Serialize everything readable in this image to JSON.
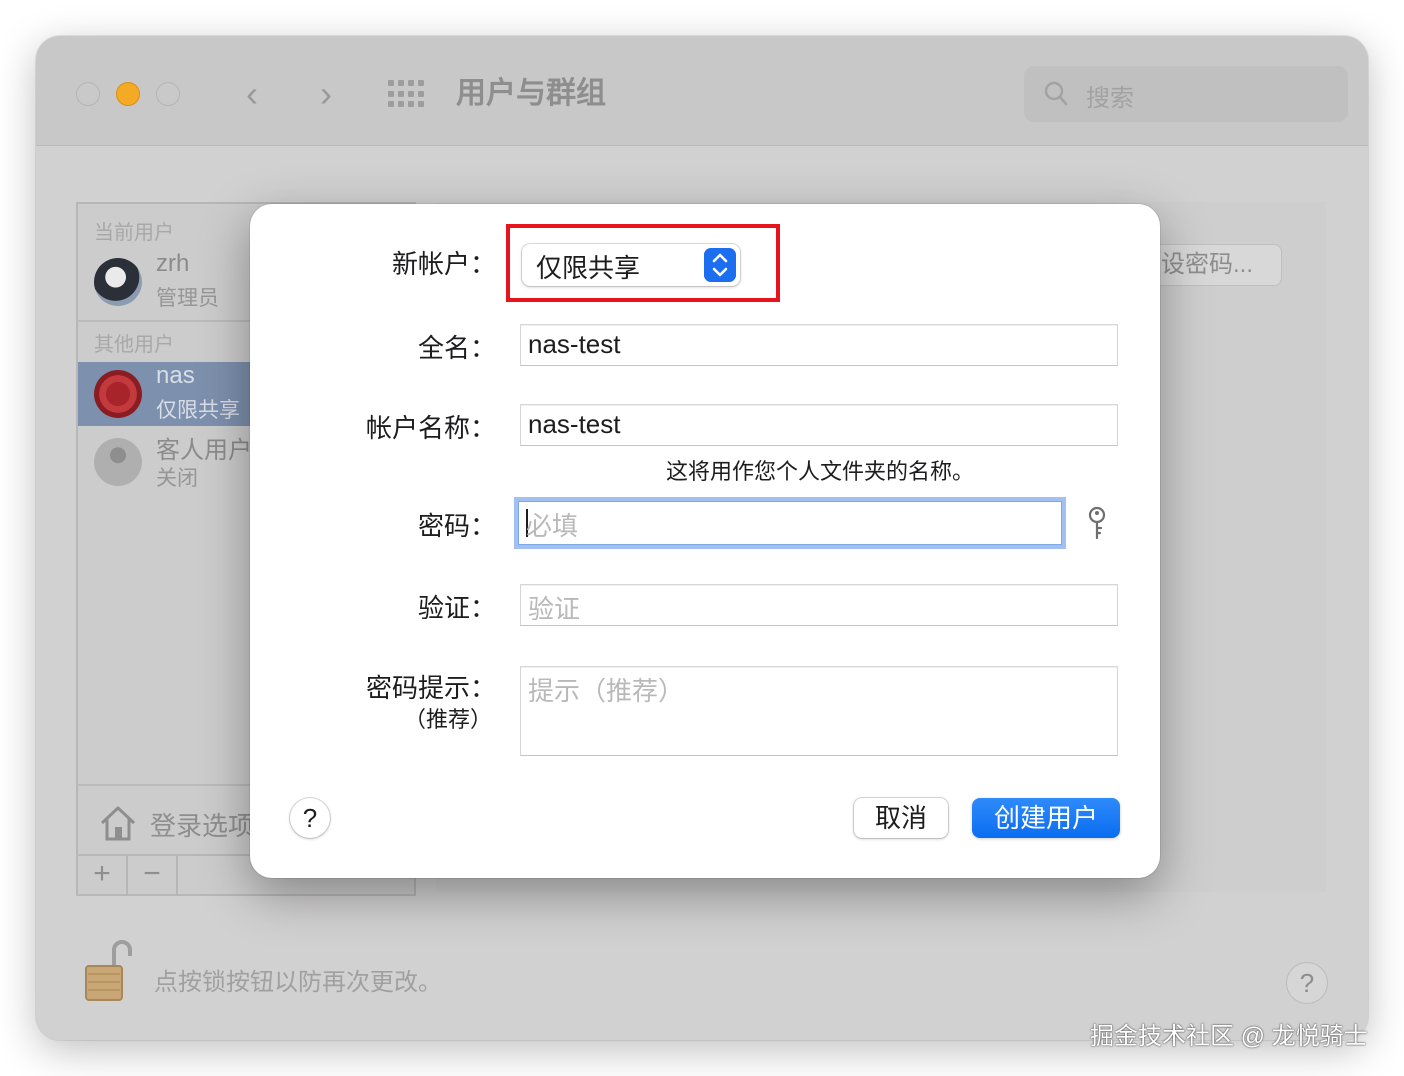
{
  "window": {
    "title": "用户与群组",
    "search_placeholder": "搜索"
  },
  "sidebar": {
    "current_users_label": "当前用户",
    "other_users_label": "其他用户",
    "users": [
      {
        "name": "zrh",
        "role": "管理员"
      },
      {
        "name": "nas",
        "role": "仅限共享"
      },
      {
        "name": "客人用户",
        "role": "关闭"
      }
    ],
    "login_options_label": "登录选项",
    "add_symbol": "+",
    "remove_symbol": "−"
  },
  "right_pane": {
    "reset_password_label": "设密码..."
  },
  "lock": {
    "text": "点按锁按钮以防再次更改。"
  },
  "help_symbol": "?",
  "dialog": {
    "new_account_label": "新帐户：",
    "new_account_value": "仅限共享",
    "full_name_label": "全名：",
    "full_name_value": "nas-test",
    "account_name_label": "帐户名称：",
    "account_name_value": "nas-test",
    "account_name_hint": "这将用作您个人文件夹的名称。",
    "password_label": "密码：",
    "password_placeholder": "必填",
    "verify_label": "验证：",
    "verify_placeholder": "验证",
    "hint_label": "密码提示：",
    "hint_sublabel": "（推荐）",
    "hint_placeholder": "提示（推荐）",
    "help_symbol": "?",
    "cancel_label": "取消",
    "create_label": "创建用户"
  },
  "colors": {
    "accent": "#0a6cf0",
    "highlight_box": "#e8141d",
    "selected_row": "#7d90ad"
  },
  "watermark": "掘金技术社区 @ 龙悦骑士"
}
